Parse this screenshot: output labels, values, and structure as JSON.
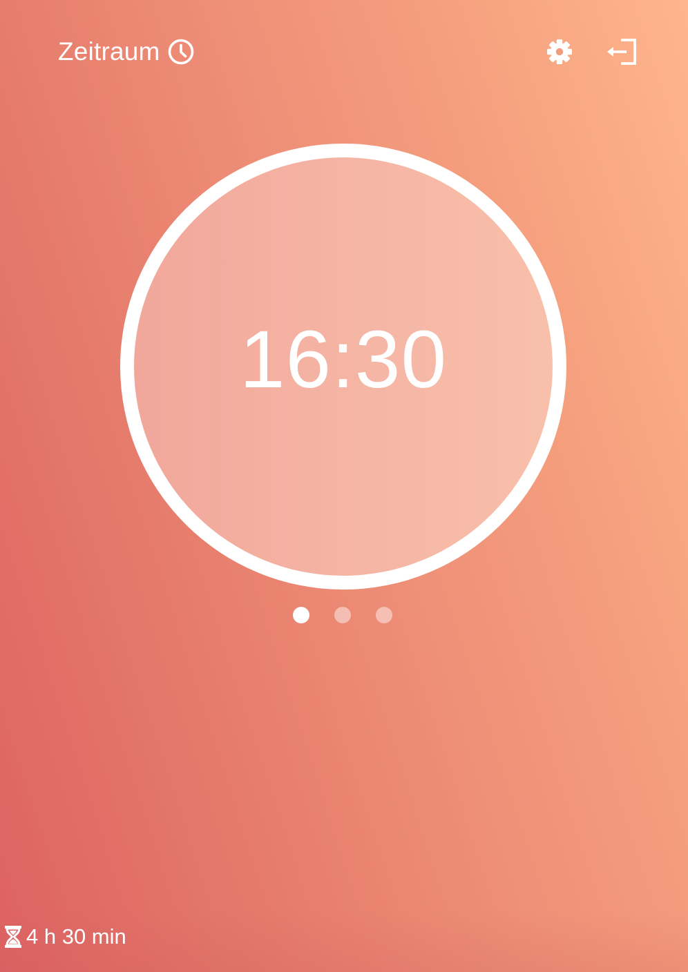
{
  "header": {
    "range_label": "Zeitraum",
    "range_icon": "clock-icon",
    "settings_icon": "gear-icon",
    "exit_icon": "logout-icon"
  },
  "timer": {
    "time": "16:30"
  },
  "pager": {
    "count": 3,
    "active_index": 0
  },
  "footer": {
    "duration_icon": "hourglass-icon",
    "duration": "4 h 30 min"
  },
  "colors": {
    "gradient_start": "#dd6262",
    "gradient_end": "#ffb58c",
    "text": "#ffffff"
  }
}
